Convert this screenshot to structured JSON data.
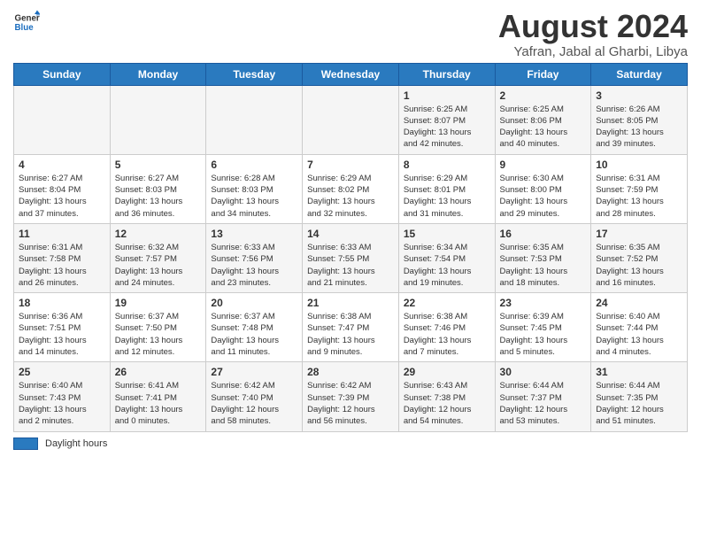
{
  "logo": {
    "general": "General",
    "blue": "Blue"
  },
  "title": "August 2024",
  "subtitle": "Yafran, Jabal al Gharbi, Libya",
  "days_of_week": [
    "Sunday",
    "Monday",
    "Tuesday",
    "Wednesday",
    "Thursday",
    "Friday",
    "Saturday"
  ],
  "footer": {
    "swatch_label": "Daylight hours"
  },
  "weeks": [
    [
      {
        "day": "",
        "detail": ""
      },
      {
        "day": "",
        "detail": ""
      },
      {
        "day": "",
        "detail": ""
      },
      {
        "day": "",
        "detail": ""
      },
      {
        "day": "1",
        "detail": "Sunrise: 6:25 AM\nSunset: 8:07 PM\nDaylight: 13 hours\nand 42 minutes."
      },
      {
        "day": "2",
        "detail": "Sunrise: 6:25 AM\nSunset: 8:06 PM\nDaylight: 13 hours\nand 40 minutes."
      },
      {
        "day": "3",
        "detail": "Sunrise: 6:26 AM\nSunset: 8:05 PM\nDaylight: 13 hours\nand 39 minutes."
      }
    ],
    [
      {
        "day": "4",
        "detail": "Sunrise: 6:27 AM\nSunset: 8:04 PM\nDaylight: 13 hours\nand 37 minutes."
      },
      {
        "day": "5",
        "detail": "Sunrise: 6:27 AM\nSunset: 8:03 PM\nDaylight: 13 hours\nand 36 minutes."
      },
      {
        "day": "6",
        "detail": "Sunrise: 6:28 AM\nSunset: 8:03 PM\nDaylight: 13 hours\nand 34 minutes."
      },
      {
        "day": "7",
        "detail": "Sunrise: 6:29 AM\nSunset: 8:02 PM\nDaylight: 13 hours\nand 32 minutes."
      },
      {
        "day": "8",
        "detail": "Sunrise: 6:29 AM\nSunset: 8:01 PM\nDaylight: 13 hours\nand 31 minutes."
      },
      {
        "day": "9",
        "detail": "Sunrise: 6:30 AM\nSunset: 8:00 PM\nDaylight: 13 hours\nand 29 minutes."
      },
      {
        "day": "10",
        "detail": "Sunrise: 6:31 AM\nSunset: 7:59 PM\nDaylight: 13 hours\nand 28 minutes."
      }
    ],
    [
      {
        "day": "11",
        "detail": "Sunrise: 6:31 AM\nSunset: 7:58 PM\nDaylight: 13 hours\nand 26 minutes."
      },
      {
        "day": "12",
        "detail": "Sunrise: 6:32 AM\nSunset: 7:57 PM\nDaylight: 13 hours\nand 24 minutes."
      },
      {
        "day": "13",
        "detail": "Sunrise: 6:33 AM\nSunset: 7:56 PM\nDaylight: 13 hours\nand 23 minutes."
      },
      {
        "day": "14",
        "detail": "Sunrise: 6:33 AM\nSunset: 7:55 PM\nDaylight: 13 hours\nand 21 minutes."
      },
      {
        "day": "15",
        "detail": "Sunrise: 6:34 AM\nSunset: 7:54 PM\nDaylight: 13 hours\nand 19 minutes."
      },
      {
        "day": "16",
        "detail": "Sunrise: 6:35 AM\nSunset: 7:53 PM\nDaylight: 13 hours\nand 18 minutes."
      },
      {
        "day": "17",
        "detail": "Sunrise: 6:35 AM\nSunset: 7:52 PM\nDaylight: 13 hours\nand 16 minutes."
      }
    ],
    [
      {
        "day": "18",
        "detail": "Sunrise: 6:36 AM\nSunset: 7:51 PM\nDaylight: 13 hours\nand 14 minutes."
      },
      {
        "day": "19",
        "detail": "Sunrise: 6:37 AM\nSunset: 7:50 PM\nDaylight: 13 hours\nand 12 minutes."
      },
      {
        "day": "20",
        "detail": "Sunrise: 6:37 AM\nSunset: 7:48 PM\nDaylight: 13 hours\nand 11 minutes."
      },
      {
        "day": "21",
        "detail": "Sunrise: 6:38 AM\nSunset: 7:47 PM\nDaylight: 13 hours\nand 9 minutes."
      },
      {
        "day": "22",
        "detail": "Sunrise: 6:38 AM\nSunset: 7:46 PM\nDaylight: 13 hours\nand 7 minutes."
      },
      {
        "day": "23",
        "detail": "Sunrise: 6:39 AM\nSunset: 7:45 PM\nDaylight: 13 hours\nand 5 minutes."
      },
      {
        "day": "24",
        "detail": "Sunrise: 6:40 AM\nSunset: 7:44 PM\nDaylight: 13 hours\nand 4 minutes."
      }
    ],
    [
      {
        "day": "25",
        "detail": "Sunrise: 6:40 AM\nSunset: 7:43 PM\nDaylight: 13 hours\nand 2 minutes."
      },
      {
        "day": "26",
        "detail": "Sunrise: 6:41 AM\nSunset: 7:41 PM\nDaylight: 13 hours\nand 0 minutes."
      },
      {
        "day": "27",
        "detail": "Sunrise: 6:42 AM\nSunset: 7:40 PM\nDaylight: 12 hours\nand 58 minutes."
      },
      {
        "day": "28",
        "detail": "Sunrise: 6:42 AM\nSunset: 7:39 PM\nDaylight: 12 hours\nand 56 minutes."
      },
      {
        "day": "29",
        "detail": "Sunrise: 6:43 AM\nSunset: 7:38 PM\nDaylight: 12 hours\nand 54 minutes."
      },
      {
        "day": "30",
        "detail": "Sunrise: 6:44 AM\nSunset: 7:37 PM\nDaylight: 12 hours\nand 53 minutes."
      },
      {
        "day": "31",
        "detail": "Sunrise: 6:44 AM\nSunset: 7:35 PM\nDaylight: 12 hours\nand 51 minutes."
      }
    ]
  ]
}
